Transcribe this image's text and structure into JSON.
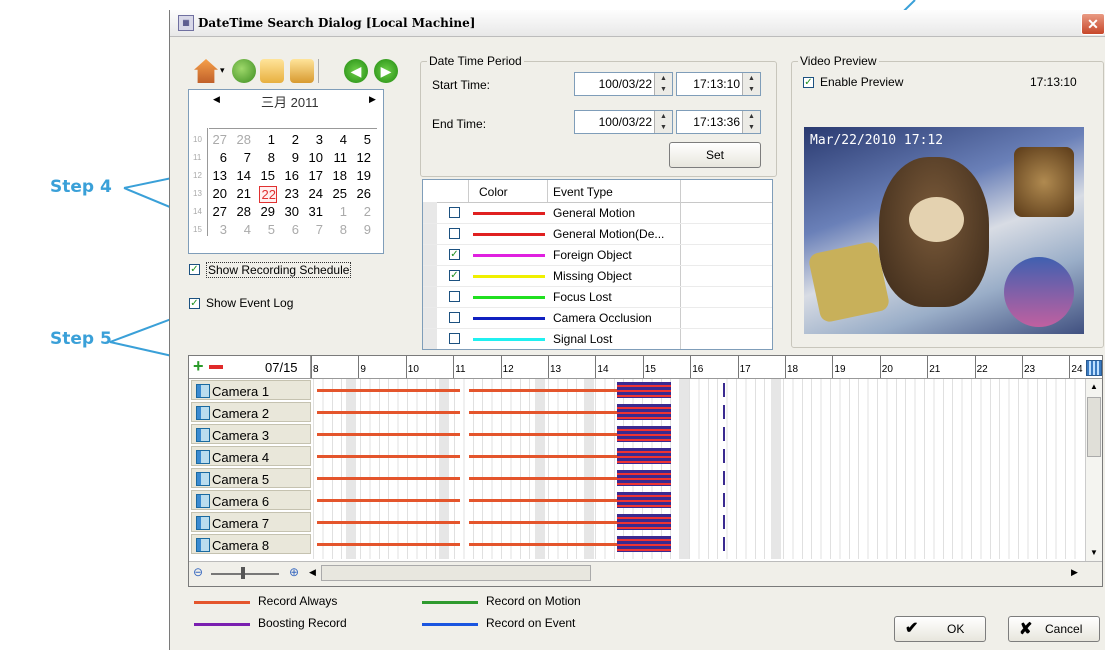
{
  "annotations": {
    "step4": "Step 4",
    "step5": "Step 5"
  },
  "window": {
    "title": "DateTime Search Dialog  [Local Machine]",
    "close": "✕"
  },
  "calendar": {
    "month_label": "三月 2011",
    "weeks": [
      {
        "wk": "10",
        "days": [
          "27",
          "28",
          "1",
          "2",
          "3",
          "4",
          "5"
        ]
      },
      {
        "wk": "11",
        "days": [
          "6",
          "7",
          "8",
          "9",
          "10",
          "11",
          "12"
        ]
      },
      {
        "wk": "12",
        "days": [
          "13",
          "14",
          "15",
          "16",
          "17",
          "18",
          "19"
        ]
      },
      {
        "wk": "13",
        "days": [
          "20",
          "21",
          "22",
          "23",
          "24",
          "25",
          "26"
        ]
      },
      {
        "wk": "14",
        "days": [
          "27",
          "28",
          "29",
          "30",
          "31",
          "1",
          "2"
        ]
      },
      {
        "wk": "15",
        "days": [
          "3",
          "4",
          "5",
          "6",
          "7",
          "8",
          "9"
        ]
      }
    ],
    "selected": "22"
  },
  "options": {
    "show_recording_schedule": "Show Recording Schedule",
    "show_event_log": "Show Event Log"
  },
  "period": {
    "group_title": "Date Time Period",
    "start_label": "Start Time:",
    "start_date": "100/03/22",
    "start_time": "17:13:10",
    "end_label": "End Time:",
    "end_date": "100/03/22",
    "end_time": "17:13:36",
    "set_label": "Set"
  },
  "events": {
    "col_color": "Color",
    "col_type": "Event Type",
    "rows": [
      {
        "name": "General Motion",
        "color": "#e02020",
        "checked": false
      },
      {
        "name": "General Motion(De...",
        "color": "#e02020",
        "checked": false
      },
      {
        "name": "Foreign Object",
        "color": "#e020e0",
        "checked": true
      },
      {
        "name": "Missing Object",
        "color": "#f0f000",
        "checked": true
      },
      {
        "name": "Focus Lost",
        "color": "#20e020",
        "checked": false
      },
      {
        "name": "Camera Occlusion",
        "color": "#1020c0",
        "checked": false
      },
      {
        "name": "Signal Lost",
        "color": "#20f0f0",
        "checked": false
      }
    ]
  },
  "preview": {
    "group_title": "Video Preview",
    "enable_label": "Enable Preview",
    "time": "17:13:10",
    "overlay": "Mar/22/2010 17:12"
  },
  "timeline": {
    "date_label": "07/15",
    "hours": [
      "8",
      "9",
      "10",
      "11",
      "12",
      "13",
      "14",
      "15",
      "16",
      "17",
      "18",
      "19",
      "20",
      "21",
      "22",
      "23",
      "24"
    ],
    "cameras": [
      "Camera 1",
      "Camera 2",
      "Camera 3",
      "Camera 4",
      "Camera 5",
      "Camera 6",
      "Camera 7",
      "Camera 8"
    ]
  },
  "legend": {
    "record_always": "Record Always",
    "record_on_motion": "Record on Motion",
    "boosting_record": "Boosting Record",
    "record_on_event": "Record on Event",
    "colors": {
      "always": "#e4552c",
      "motion": "#2e9a2e",
      "boosting": "#7a1fb0",
      "event": "#1a55e0"
    }
  },
  "buttons": {
    "ok": "OK",
    "cancel": "Cancel"
  }
}
